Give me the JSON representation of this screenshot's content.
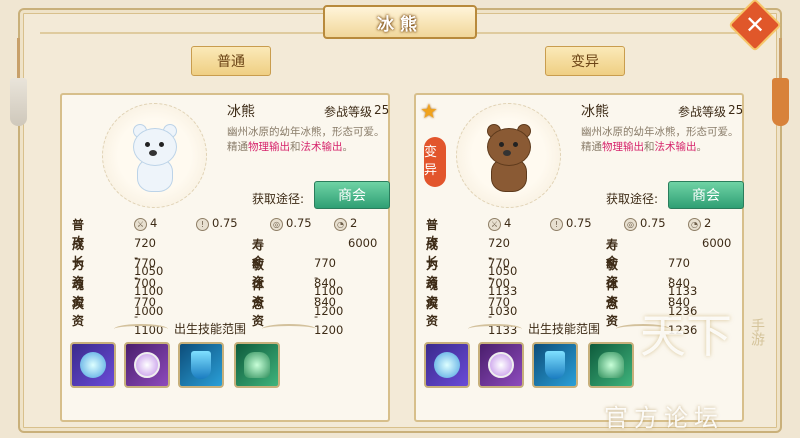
{
  "window": {
    "title": "冰熊"
  },
  "tabs": {
    "normal_label": "普通",
    "mutant_label": "变异"
  },
  "panels": {
    "normal": {
      "name": "冰熊",
      "level_label": "参战等级",
      "level": "25",
      "desc_line1": "幽州冰原的幼年冰熊，形态可爱。",
      "desc_pre": "精通",
      "desc_skill1": "物理输出",
      "desc_mid": "和",
      "desc_skill2": "法术输出",
      "desc_post": "。",
      "obtain_label": "获取途径:",
      "shop_label": "商会",
      "attack_label": "普攻",
      "attack_stats": [
        "4",
        "0.75",
        "0.75",
        "2"
      ],
      "stats_left": [
        {
          "label": "成长",
          "value": "720 - 1050"
        },
        {
          "label": "力资",
          "value": "770 - 1100"
        },
        {
          "label": "魂资",
          "value": "700 - 1000"
        },
        {
          "label": "疾资",
          "value": "770 - 1100"
        }
      ],
      "stats_right": [
        {
          "label": "寿命",
          "value": "6000"
        },
        {
          "label": "敏资",
          "value": "770 - 1100"
        },
        {
          "label": "体资",
          "value": "840 - 1200"
        },
        {
          "label": "念资",
          "value": "840 - 1200"
        }
      ],
      "skill_title": "出生技能范围",
      "skills": [
        "ice-orb-skill-icon",
        "arcane-target-skill-icon",
        "shield-skill-icon",
        "poison-body-skill-icon"
      ]
    },
    "mutant": {
      "name": "冰熊",
      "badge": "变异",
      "level_label": "参战等级",
      "level": "25",
      "desc_line1": "幽州冰原的幼年冰熊，形态可爱。",
      "desc_pre": "精通",
      "desc_skill1": "物理输出",
      "desc_mid": "和",
      "desc_skill2": "法术输出",
      "desc_post": "。",
      "obtain_label": "获取途径:",
      "shop_label": "商会",
      "attack_label": "普攻",
      "attack_stats": [
        "4",
        "0.75",
        "0.75",
        "2"
      ],
      "stats_left": [
        {
          "label": "成长",
          "value": "720 - 1050"
        },
        {
          "label": "力资",
          "value": "770 - 1133"
        },
        {
          "label": "魂资",
          "value": "700 - 1030"
        },
        {
          "label": "疾资",
          "value": "770 - 1133"
        }
      ],
      "stats_right": [
        {
          "label": "寿命",
          "value": "6000"
        },
        {
          "label": "敏资",
          "value": "770 - 1133"
        },
        {
          "label": "体资",
          "value": "840 - 1236"
        },
        {
          "label": "念资",
          "value": "840 - 1236"
        }
      ],
      "skill_title": "出生技能范围",
      "skills": [
        "ice-orb-skill-icon",
        "arcane-target-skill-icon",
        "shield-skill-icon",
        "poison-body-skill-icon"
      ]
    }
  },
  "watermark": {
    "big": "天下",
    "sub": "手游",
    "forum": "官方论坛"
  },
  "colors": {
    "accent_red": "#d6236b",
    "shop_green": "#2f9f74",
    "close_orange": "#e0572a"
  }
}
